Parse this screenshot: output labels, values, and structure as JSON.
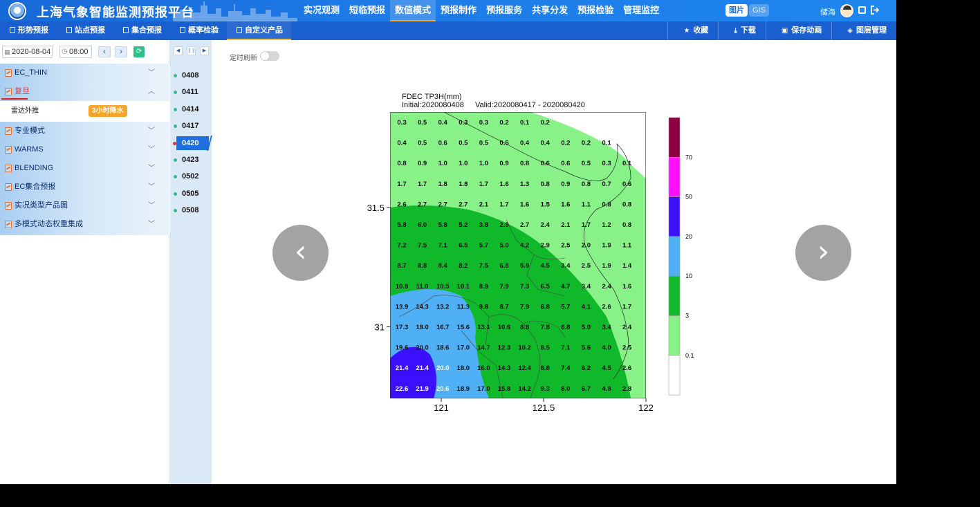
{
  "app": {
    "title": "上海气象智能监测预报平台"
  },
  "main_nav": [
    {
      "label": "实况观测",
      "active": false
    },
    {
      "label": "短临预报",
      "active": false
    },
    {
      "label": "数值模式",
      "active": true
    },
    {
      "label": "预报制作",
      "active": false
    },
    {
      "label": "预报服务",
      "active": false
    },
    {
      "label": "共享分发",
      "active": false
    },
    {
      "label": "预报检验",
      "active": false
    },
    {
      "label": "管理监控",
      "active": false
    }
  ],
  "header_right": {
    "image_label": "图片",
    "gis_label": "GIS",
    "user_name": "储海"
  },
  "sub_nav": [
    {
      "label": "形势预报",
      "active": false
    },
    {
      "label": "站点预报",
      "active": false
    },
    {
      "label": "集合预报",
      "active": false
    },
    {
      "label": "概率检验",
      "active": false
    },
    {
      "label": "自定义产品",
      "active": true
    }
  ],
  "sub_actions": [
    {
      "label": "收藏",
      "icon": "star-icon"
    },
    {
      "label": "下载",
      "icon": "download-icon"
    },
    {
      "label": "保存动画",
      "icon": "save-icon"
    },
    {
      "label": "图层管理",
      "icon": "layers-icon"
    }
  ],
  "controls": {
    "date": "2020-08-04",
    "time": "08:00"
  },
  "sidebar": {
    "items": [
      {
        "label": "EC_THIN",
        "open": false
      },
      {
        "label": "复旦",
        "open": true,
        "children": [
          {
            "label": "雷达外推",
            "tag": "3小时降水"
          }
        ]
      },
      {
        "label": "专业模式",
        "open": false
      },
      {
        "label": "WARMS",
        "open": false
      },
      {
        "label": "BLENDING",
        "open": false
      },
      {
        "label": "EC集合预报",
        "open": false
      },
      {
        "label": "实况类型产品图",
        "open": false
      },
      {
        "label": "多模式动态权重集成",
        "open": false
      }
    ]
  },
  "times": {
    "items": [
      "0408",
      "0411",
      "0414",
      "0417",
      "0420",
      "0423",
      "0502",
      "0505",
      "0508"
    ],
    "active": "0420"
  },
  "content": {
    "refresh_label": "定时刷新",
    "refresh_on": false
  },
  "chart_data": {
    "type": "heatmap",
    "title": "FDEC TP3H(mm)",
    "subtitle_left": "Initial:2020080408",
    "subtitle_right": "Valid:2020080417 - 2020080420",
    "x_ticks": [
      "121",
      "121.5",
      "122"
    ],
    "y_ticks": [
      "31.5",
      "31"
    ],
    "xlim": [
      120.75,
      122
    ],
    "ylim": [
      30.7,
      31.9
    ],
    "colorbar": {
      "levels": [
        "0.1",
        "3",
        "10",
        "20",
        "50",
        "70"
      ],
      "colors": [
        "#ffffff",
        "#88f188",
        "#10b92a",
        "#4fb0f5",
        "#3a10ff",
        "#ff10ff",
        "#8c0040"
      ]
    },
    "grid": [
      [
        "0.3",
        "0.5",
        "0.4",
        "0.3",
        "0.3",
        "0.2",
        "0.1",
        "0.2",
        "",
        "",
        "",
        ""
      ],
      [
        "0.4",
        "0.5",
        "0.6",
        "0.5",
        "0.5",
        "0.5",
        "0.4",
        "0.4",
        "0.2",
        "0.2",
        "0.1",
        ""
      ],
      [
        "0.8",
        "0.9",
        "1.0",
        "1.0",
        "1.0",
        "0.9",
        "0.8",
        "0.6",
        "0.6",
        "0.5",
        "0.3",
        "0.1"
      ],
      [
        "1.7",
        "1.7",
        "1.8",
        "1.8",
        "1.7",
        "1.6",
        "1.3",
        "0.8",
        "0.9",
        "0.8",
        "0.7",
        "0.6"
      ],
      [
        "2.6",
        "2.7",
        "2.7",
        "2.7",
        "2.1",
        "1.7",
        "1.6",
        "1.5",
        "1.6",
        "1.1",
        "0.8",
        "0.8"
      ],
      [
        "5.8",
        "6.0",
        "5.8",
        "5.2",
        "3.8",
        "2.9",
        "2.7",
        "2.4",
        "2.1",
        "1.7",
        "1.2",
        "0.8"
      ],
      [
        "7.2",
        "7.5",
        "7.1",
        "6.5",
        "5.7",
        "5.0",
        "4.2",
        "2.9",
        "2.5",
        "2.0",
        "1.9",
        "1.1"
      ],
      [
        "8.7",
        "8.8",
        "8.4",
        "8.2",
        "7.5",
        "6.8",
        "5.9",
        "4.5",
        "3.4",
        "2.5",
        "1.9",
        "1.4"
      ],
      [
        "10.9",
        "11.0",
        "10.5",
        "10.1",
        "8.9",
        "7.9",
        "7.3",
        "6.5",
        "4.7",
        "3.4",
        "2.4",
        "1.6"
      ],
      [
        "13.9",
        "14.3",
        "13.2",
        "11.3",
        "9.8",
        "8.7",
        "7.9",
        "6.8",
        "5.7",
        "4.1",
        "2.6",
        "1.7"
      ],
      [
        "17.3",
        "18.0",
        "16.7",
        "15.6",
        "13.1",
        "10.6",
        "8.8",
        "7.8",
        "6.8",
        "5.0",
        "3.4",
        "2.4"
      ],
      [
        "19.6",
        "20.0",
        "18.6",
        "17.0",
        "14.7",
        "12.3",
        "10.2",
        "8.5",
        "7.1",
        "5.6",
        "4.0",
        "2.5"
      ],
      [
        "21.4",
        "21.4",
        "20.0",
        "18.0",
        "16.0",
        "14.3",
        "12.4",
        "8.8",
        "7.4",
        "6.2",
        "4.5",
        "2.6"
      ],
      [
        "22.6",
        "21.9",
        "20.6",
        "18.9",
        "17.0",
        "15.8",
        "14.2",
        "9.3",
        "8.0",
        "6.7",
        "4.8",
        "2.8"
      ]
    ]
  }
}
